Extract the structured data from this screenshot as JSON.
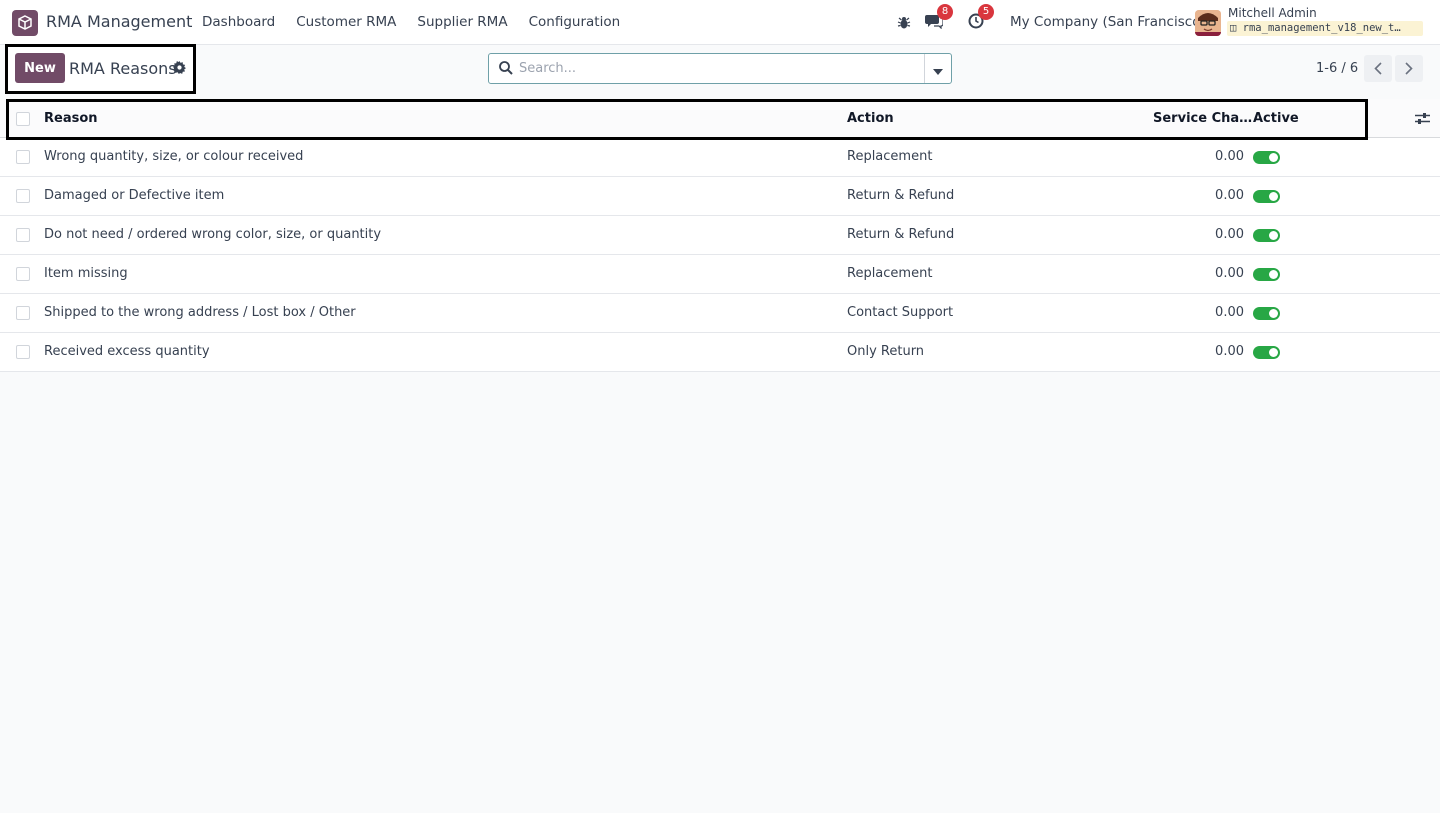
{
  "navbar": {
    "app_name": "RMA Management",
    "menu": [
      "Dashboard",
      "Customer RMA",
      "Supplier RMA",
      "Configuration"
    ],
    "messages_count": "8",
    "activities_count": "5",
    "company": "My Company (San Francisco)",
    "user_name": "Mitchell Admin",
    "database": "rma_management_v18_new_t…"
  },
  "control_panel": {
    "new_label": "New",
    "title": "RMA Reasons",
    "search_placeholder": "Search...",
    "pager": "1-6 / 6"
  },
  "table": {
    "headers": {
      "reason": "Reason",
      "action": "Action",
      "service_charge": "Service Cha…",
      "active": "Active"
    },
    "rows": [
      {
        "reason": "Wrong quantity, size, or colour received",
        "action": "Replacement",
        "service_charge": "0.00",
        "active": true
      },
      {
        "reason": "Damaged or Defective item",
        "action": "Return & Refund",
        "service_charge": "0.00",
        "active": true
      },
      {
        "reason": "Do not need / ordered wrong color, size, or quantity",
        "action": "Return & Refund",
        "service_charge": "0.00",
        "active": true
      },
      {
        "reason": "Item missing",
        "action": "Replacement",
        "service_charge": "0.00",
        "active": true
      },
      {
        "reason": "Shipped to the wrong address / Lost box / Other",
        "action": "Contact Support",
        "service_charge": "0.00",
        "active": true
      },
      {
        "reason": "Received excess quantity",
        "action": "Only Return",
        "service_charge": "0.00",
        "active": true
      }
    ]
  },
  "colors": {
    "brand": "#714b67",
    "toggle_on": "#28a745",
    "badge": "#d9363e"
  },
  "icons": [
    "app-logo-icon",
    "bug-icon",
    "chat-icon",
    "clock-icon",
    "database-icon",
    "gear-icon",
    "search-icon",
    "caret-down-icon",
    "chevron-left-icon",
    "chevron-right-icon",
    "sliders-icon"
  ]
}
